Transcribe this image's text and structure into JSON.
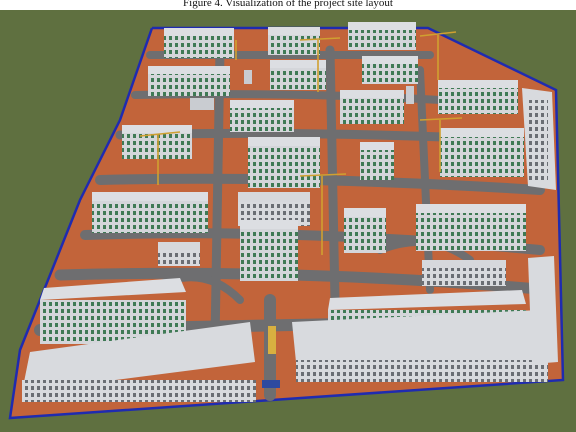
{
  "caption": "Figure 4. Visualization of the project site layout",
  "colors": {
    "grass": "#5f7040",
    "soil": "#c2643a",
    "road": "#6e6e70",
    "boundary": "#1f2bb0",
    "building_wall": "#c9ccd1",
    "building_roof": "#d9dbe0",
    "window": "#3f7a55",
    "crane": "#d0a030"
  }
}
